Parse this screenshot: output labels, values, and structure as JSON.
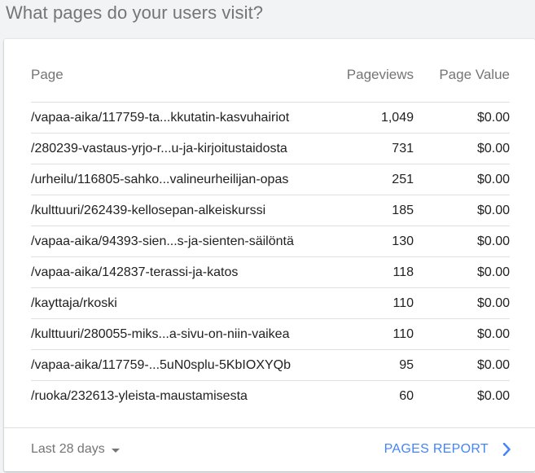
{
  "heading": "What pages do your users visit?",
  "table": {
    "headers": {
      "page": "Page",
      "pageviews": "Pageviews",
      "value": "Page Value"
    },
    "rows": [
      {
        "page": "/vapaa-aika/117759-ta...kkutatin-kasvuhairiot",
        "pageviews": "1,049",
        "value": "$0.00"
      },
      {
        "page": "/280239-vastaus-yrjo-r...u-ja-kirjoitustaidosta",
        "pageviews": "731",
        "value": "$0.00"
      },
      {
        "page": "/urheilu/116805-sahko...valineurheilijan-opas",
        "pageviews": "251",
        "value": "$0.00"
      },
      {
        "page": "/kulttuuri/262439-kellosepan-alkeiskurssi",
        "pageviews": "185",
        "value": "$0.00"
      },
      {
        "page": "/vapaa-aika/94393-sien...s-ja-sienten-säilöntä",
        "pageviews": "130",
        "value": "$0.00"
      },
      {
        "page": "/vapaa-aika/142837-terassi-ja-katos",
        "pageviews": "118",
        "value": "$0.00"
      },
      {
        "page": "/kayttaja/rkoski",
        "pageviews": "110",
        "value": "$0.00"
      },
      {
        "page": "/kulttuuri/280055-miks...a-sivu-on-niin-vaikea",
        "pageviews": "110",
        "value": "$0.00"
      },
      {
        "page": "/vapaa-aika/117759-...5uN0splu-5KbIOXYQb",
        "pageviews": "95",
        "value": "$0.00"
      },
      {
        "page": "/ruoka/232613-yleista-maustamisesta",
        "pageviews": "60",
        "value": "$0.00"
      }
    ]
  },
  "footer": {
    "range_label": "Last 28 days",
    "report_label": "PAGES REPORT"
  },
  "icons": {
    "range_caret": "caret-down-icon",
    "report_chevron": "chevron-right-icon"
  },
  "colors": {
    "accent": "#4285f4",
    "muted_text": "#757575",
    "text": "#212121",
    "background": "#f1f3f4",
    "card": "#ffffff"
  }
}
